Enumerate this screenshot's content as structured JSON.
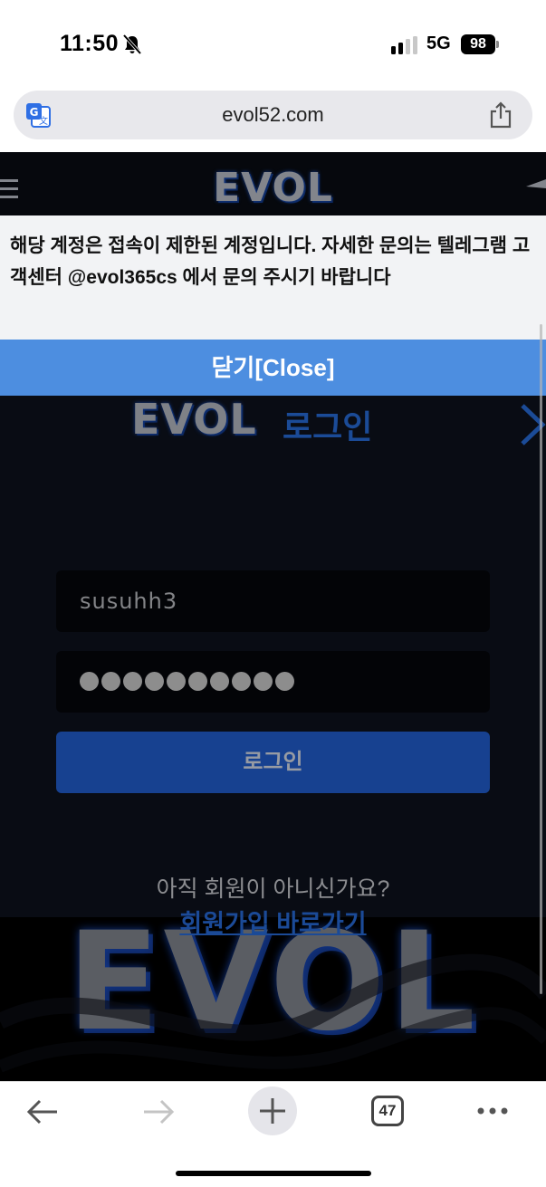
{
  "status_bar": {
    "time": "11:50",
    "network": "5G",
    "battery": "98"
  },
  "address_bar": {
    "url": "evol52.com"
  },
  "site": {
    "brand": "EVOL",
    "login_title": "로그인",
    "username_value": "susuhh3",
    "password_dot_count": 10,
    "login_button": "로그인",
    "no_account_text": "아직 회원이 아니신가요?",
    "signup_link": "회원가입 바로가기",
    "accent_color": "#2465de"
  },
  "alert": {
    "message": "해당 계정은 접속이 제한된 계정입니다. 자세한 문의는 텔레그램 고객센터 @evol365cs 에서 문의 주시기 바랍니다",
    "close_button": "닫기[Close]",
    "close_color": "#4d8ee0"
  },
  "toolbar": {
    "tab_count": "47"
  }
}
